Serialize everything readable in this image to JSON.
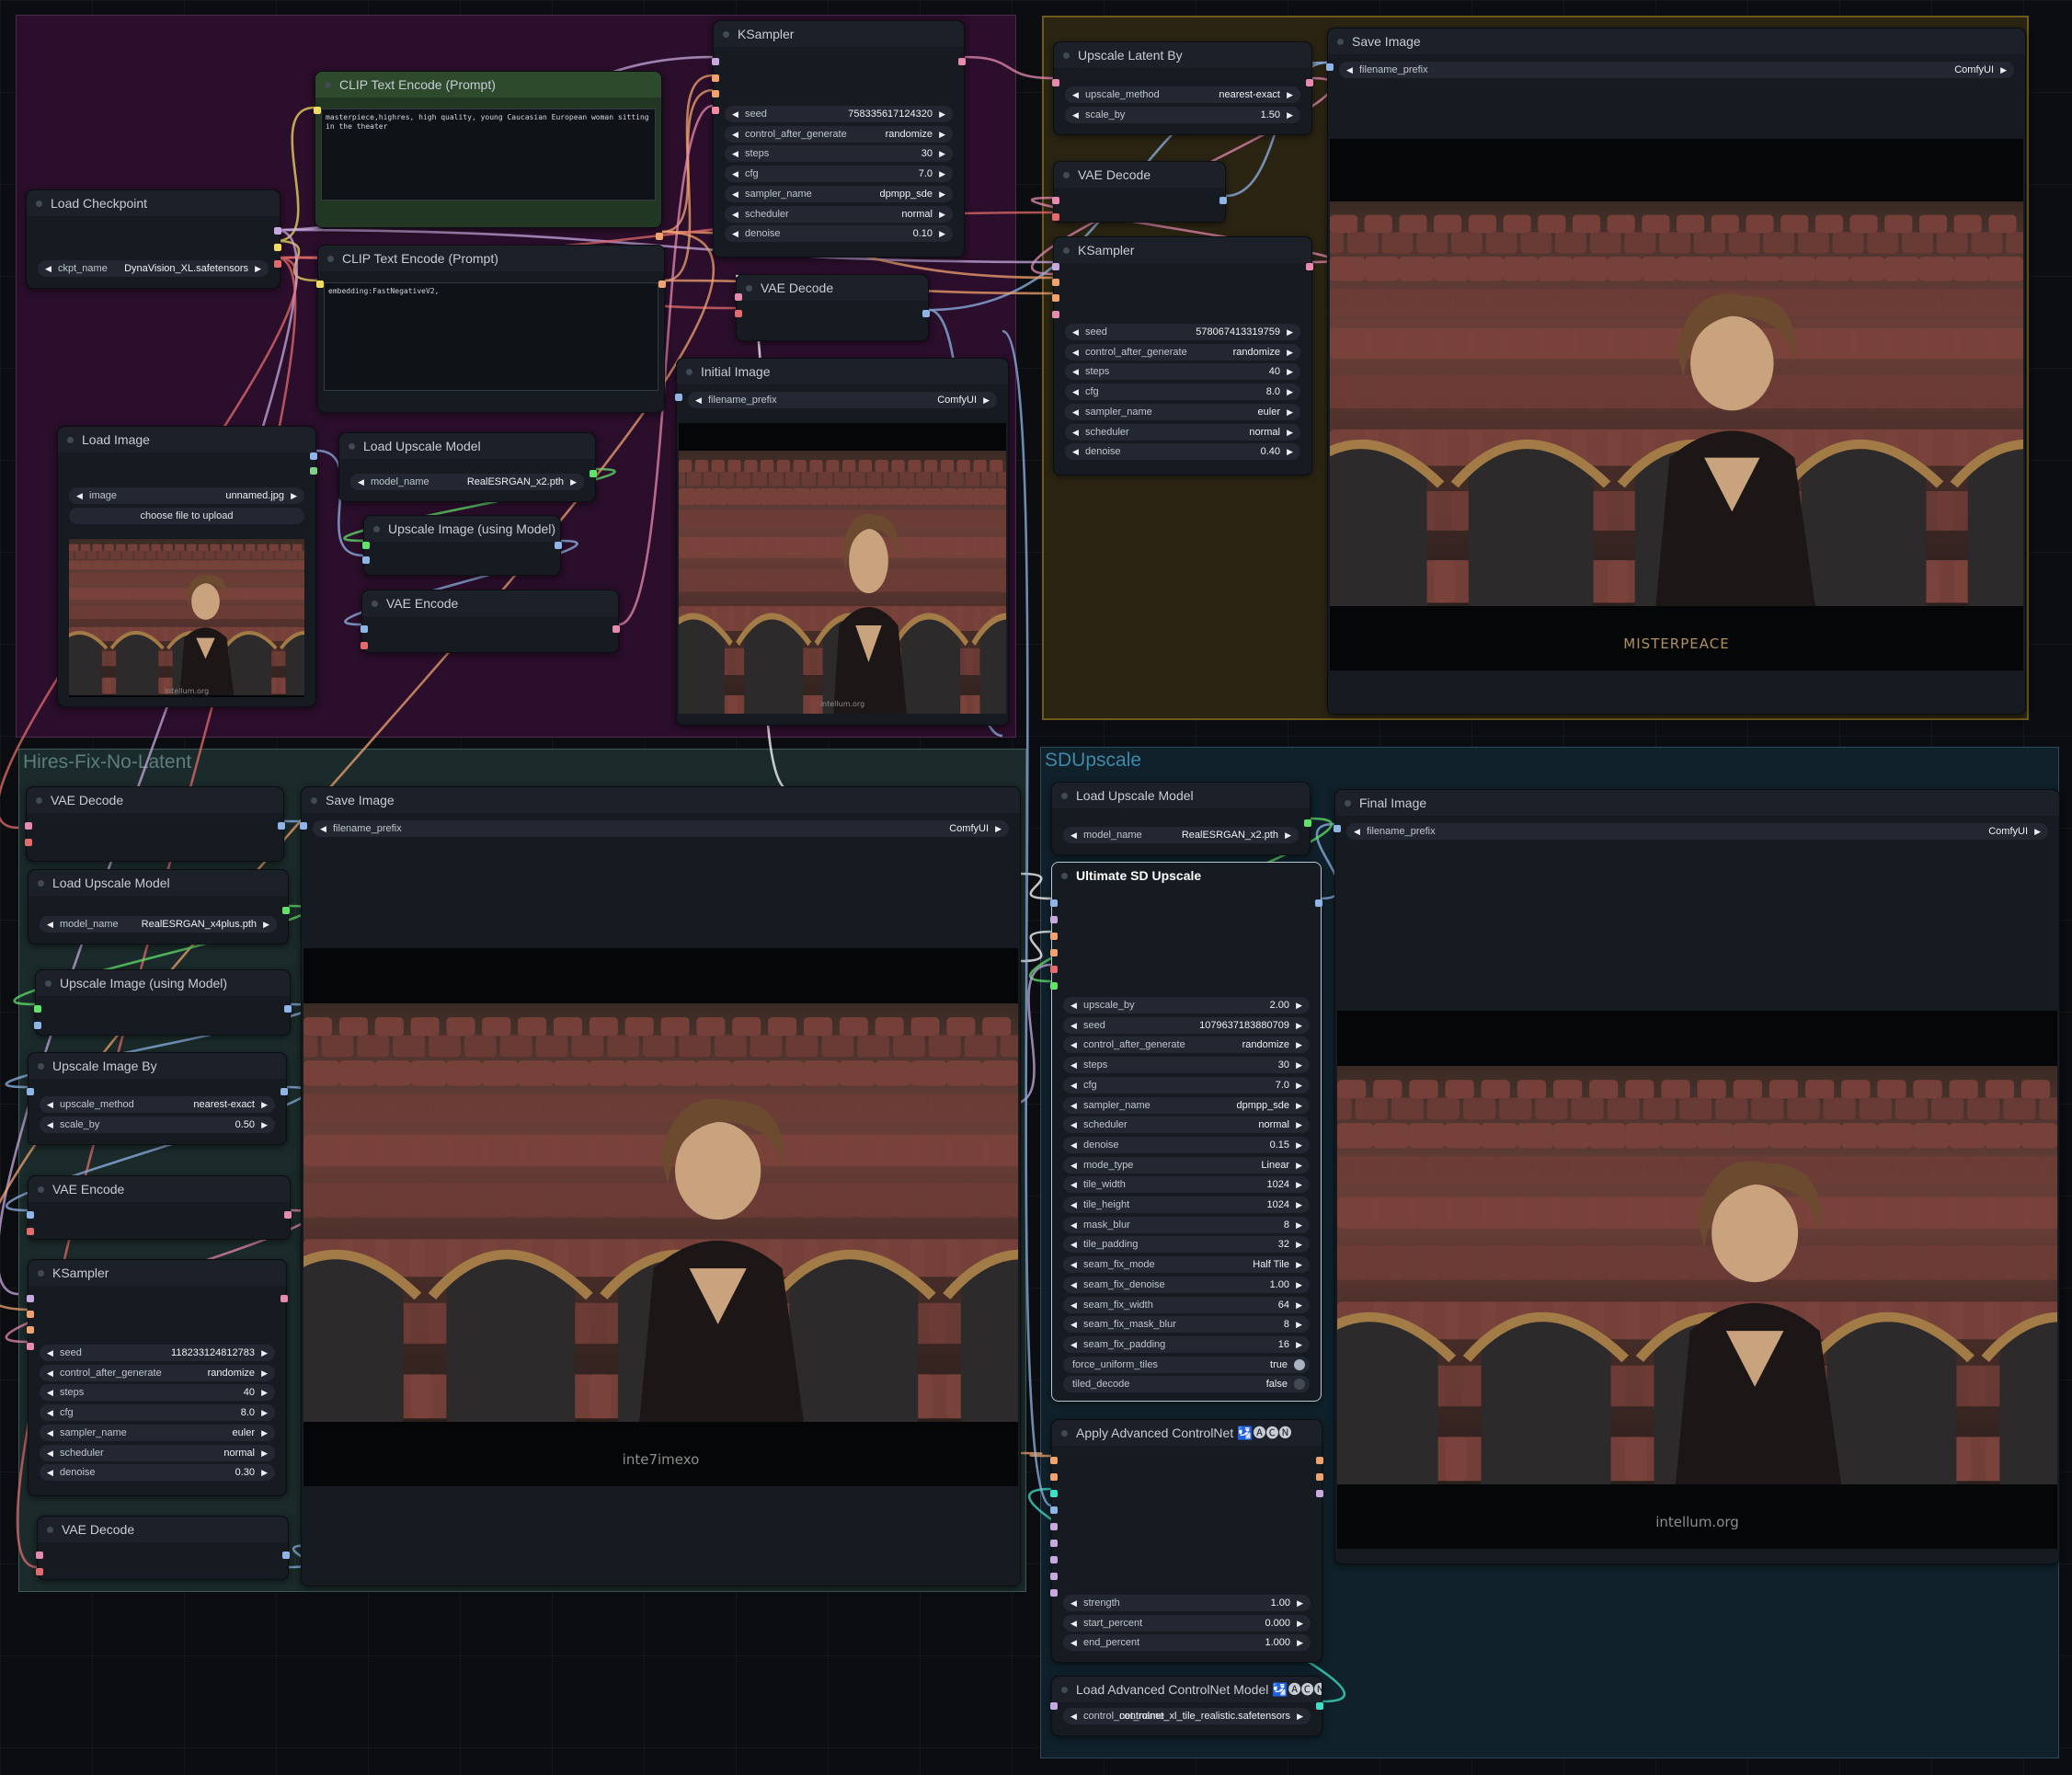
{
  "groups": {
    "hires": "Hires-Fix-No-Latent",
    "sdup": "SDUpscale"
  },
  "colors": {
    "purple_group": "#2a0e2b",
    "gold_group": "#2b2413",
    "teal_group": "#1b2a2a",
    "blue_group": "#10212b",
    "clip_green": "#2d4a2c"
  },
  "nodes": {
    "ksampler1": {
      "title": "KSampler",
      "widgets": [
        [
          "seed",
          "758335617124320"
        ],
        [
          "control_after_generate",
          "randomize"
        ],
        [
          "steps",
          "30"
        ],
        [
          "cfg",
          "7.0"
        ],
        [
          "sampler_name",
          "dpmpp_sde"
        ],
        [
          "scheduler",
          "normal"
        ],
        [
          "denoise",
          "0.10"
        ]
      ]
    },
    "clip_pos": {
      "title": "CLIP Text Encode (Prompt)",
      "text": "masterpiece,highres, high quality, young Caucasian European woman sitting in the theater"
    },
    "clip_neg": {
      "title": "CLIP Text Encode (Prompt)",
      "text": "embedding:FastNegativeV2,"
    },
    "load_ckpt": {
      "title": "Load Checkpoint",
      "widgets": [
        [
          "ckpt_name",
          "DynaVision_XL.safetensors"
        ]
      ]
    },
    "vae_decode1": {
      "title": "VAE Decode"
    },
    "initial_image": {
      "title": "Initial Image",
      "widgets": [
        [
          "filename_prefix",
          "ComfyUI"
        ]
      ],
      "watermark": "intellum.org"
    },
    "load_image": {
      "title": "Load Image",
      "widgets": [
        [
          "image",
          "unnamed.jpg"
        ]
      ],
      "button": "choose file to upload",
      "watermark": "intellum.org"
    },
    "load_upscale1": {
      "title": "Load Upscale Model",
      "widgets": [
        [
          "model_name",
          "RealESRGAN_x2.pth"
        ]
      ]
    },
    "upscale_model1": {
      "title": "Upscale Image (using Model)"
    },
    "vae_encode1": {
      "title": "VAE Encode"
    },
    "upscale_latent": {
      "title": "Upscale Latent By",
      "widgets": [
        [
          "upscale_method",
          "nearest-exact"
        ],
        [
          "scale_by",
          "1.50"
        ]
      ]
    },
    "vae_decode2": {
      "title": "VAE Decode"
    },
    "ksampler2": {
      "title": "KSampler",
      "widgets": [
        [
          "seed",
          "578067413319759"
        ],
        [
          "control_after_generate",
          "randomize"
        ],
        [
          "steps",
          "40"
        ],
        [
          "cfg",
          "8.0"
        ],
        [
          "sampler_name",
          "euler"
        ],
        [
          "scheduler",
          "normal"
        ],
        [
          "denoise",
          "0.40"
        ]
      ]
    },
    "save_image1": {
      "title": "Save Image",
      "widgets": [
        [
          "filename_prefix",
          "ComfyUI"
        ]
      ],
      "watermark": "MISTERPEACE"
    },
    "vae_decode3": {
      "title": "VAE Decode"
    },
    "save_image2": {
      "title": "Save Image",
      "widgets": [
        [
          "filename_prefix",
          "ComfyUI"
        ]
      ],
      "watermark": "inte7imexo"
    },
    "load_upscale2": {
      "title": "Load Upscale Model",
      "widgets": [
        [
          "model_name",
          "RealESRGAN_x4plus.pth"
        ]
      ]
    },
    "upscale_model2": {
      "title": "Upscale Image (using Model)"
    },
    "upscale_image_by": {
      "title": "Upscale Image By",
      "widgets": [
        [
          "upscale_method",
          "nearest-exact"
        ],
        [
          "scale_by",
          "0.50"
        ]
      ]
    },
    "vae_encode2": {
      "title": "VAE Encode"
    },
    "ksampler3": {
      "title": "KSampler",
      "widgets": [
        [
          "seed",
          "118233124812783"
        ],
        [
          "control_after_generate",
          "randomize"
        ],
        [
          "steps",
          "40"
        ],
        [
          "cfg",
          "8.0"
        ],
        [
          "sampler_name",
          "euler"
        ],
        [
          "scheduler",
          "normal"
        ],
        [
          "denoise",
          "0.30"
        ]
      ]
    },
    "vae_decode4": {
      "title": "VAE Decode"
    },
    "load_upscale3": {
      "title": "Load Upscale Model",
      "widgets": [
        [
          "model_name",
          "RealESRGAN_x2.pth"
        ]
      ]
    },
    "ultimate_sd": {
      "title": "Ultimate SD Upscale",
      "widgets": [
        [
          "upscale_by",
          "2.00"
        ],
        [
          "seed",
          "1079637183880709"
        ],
        [
          "control_after_generate",
          "randomize"
        ],
        [
          "steps",
          "30"
        ],
        [
          "cfg",
          "7.0"
        ],
        [
          "sampler_name",
          "dpmpp_sde"
        ],
        [
          "scheduler",
          "normal"
        ],
        [
          "denoise",
          "0.15"
        ],
        [
          "mode_type",
          "Linear"
        ],
        [
          "tile_width",
          "1024"
        ],
        [
          "tile_height",
          "1024"
        ],
        [
          "mask_blur",
          "8"
        ],
        [
          "tile_padding",
          "32"
        ],
        [
          "seam_fix_mode",
          "Half Tile"
        ],
        [
          "seam_fix_denoise",
          "1.00"
        ],
        [
          "seam_fix_width",
          "64"
        ],
        [
          "seam_fix_mask_blur",
          "8"
        ],
        [
          "seam_fix_padding",
          "16"
        ]
      ],
      "toggles": [
        [
          "force_uniform_tiles",
          "true"
        ],
        [
          "tiled_decode",
          "false"
        ]
      ]
    },
    "final_image": {
      "title": "Final Image",
      "widgets": [
        [
          "filename_prefix",
          "ComfyUI"
        ]
      ],
      "watermark": "intellum.org"
    },
    "apply_cn": {
      "title": "Apply Advanced ControlNet 🛂🅐🅒🅝",
      "widgets": [
        [
          "strength",
          "1.00"
        ],
        [
          "start_percent",
          "0.000"
        ],
        [
          "end_percent",
          "1.000"
        ]
      ]
    },
    "load_cn": {
      "title": "Load Advanced ControlNet Model 🛂🅐🅒🅝",
      "widgets": [
        [
          "control_net_name",
          "controlnet_xl_tile_realistic.safetensors"
        ]
      ]
    }
  }
}
